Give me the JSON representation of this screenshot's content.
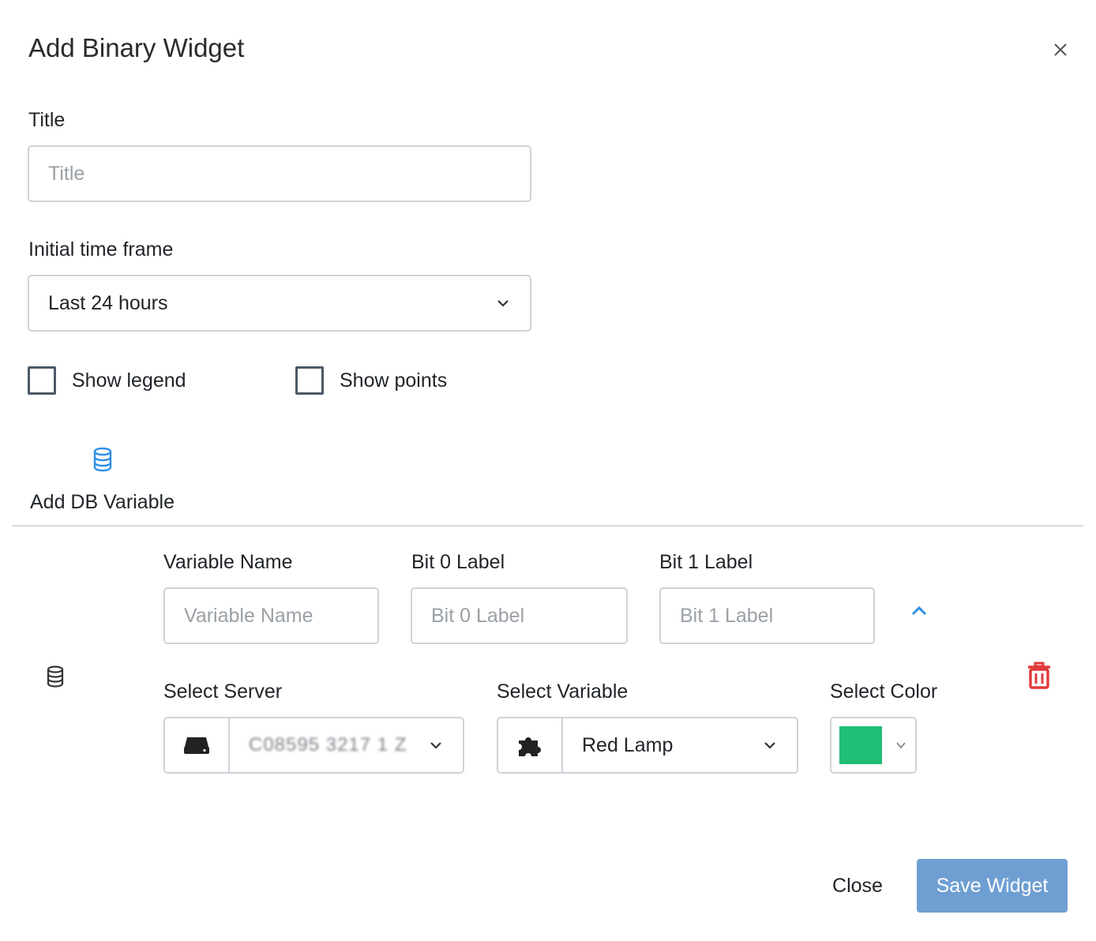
{
  "modal": {
    "title": "Add Binary Widget"
  },
  "form": {
    "title_label": "Title",
    "title_placeholder": "Title",
    "timeframe_label": "Initial time frame",
    "timeframe_value": "Last 24 hours",
    "show_legend_label": "Show legend",
    "show_points_label": "Show points",
    "show_legend_checked": false,
    "show_points_checked": false
  },
  "add_db_variable": {
    "label": "Add DB Variable",
    "icon": "database-icon"
  },
  "variable_row": {
    "variable_name_label": "Variable Name",
    "variable_name_placeholder": "Variable Name",
    "bit0_label": "Bit 0 Label",
    "bit0_placeholder": "Bit 0 Label",
    "bit1_label": "Bit 1 Label",
    "bit1_placeholder": "Bit 1 Label",
    "select_server_label": "Select Server",
    "server_value": "C08595 3217 1 Z",
    "select_variable_label": "Select Variable",
    "variable_value": "Red Lamp",
    "select_color_label": "Select Color",
    "color_value": "#20bf75"
  },
  "footer": {
    "close_label": "Close",
    "save_label": "Save Widget"
  },
  "colors": {
    "accent_blue": "#2e8ee6",
    "danger_red": "#e03a3a",
    "save_button_bg": "#6f9fd2",
    "border": "#ced4da"
  }
}
